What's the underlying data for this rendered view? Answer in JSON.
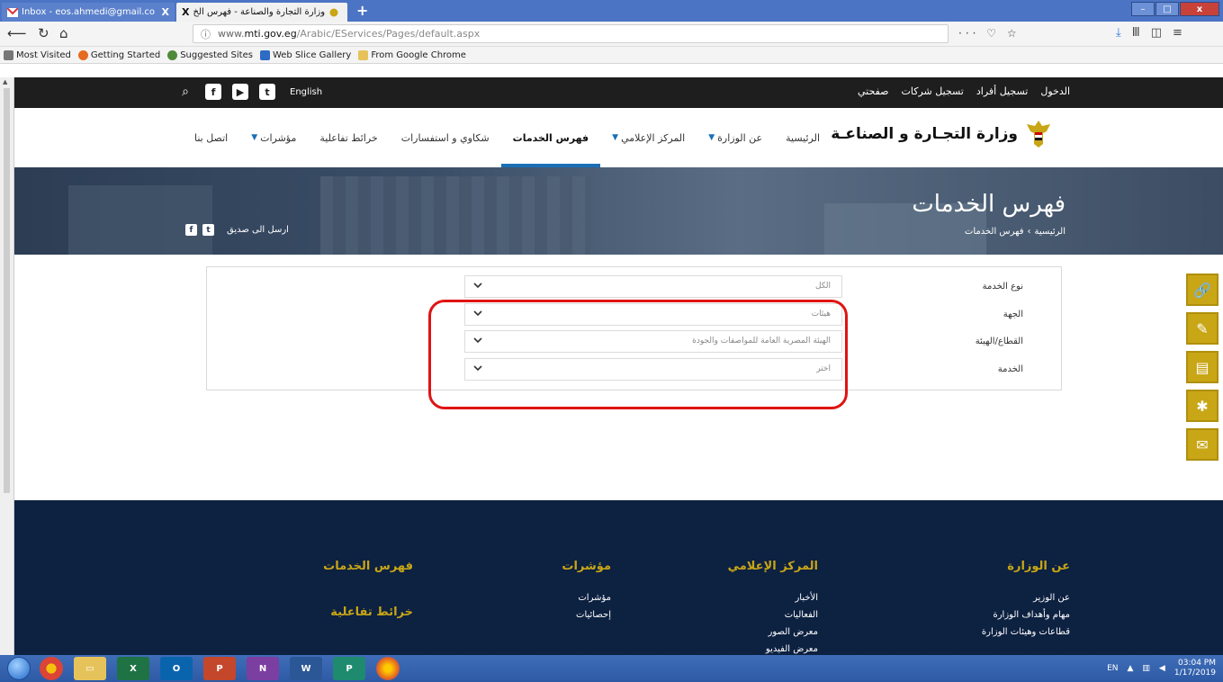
{
  "browser": {
    "tabs": [
      {
        "label": "Inbox - eos.ahmedi@gmail.co",
        "close": "X"
      },
      {
        "label": "وزارة التجارة والصناعة - فهرس الخ",
        "close": "X"
      }
    ],
    "new_tab": "+",
    "url_prefix": "www.",
    "url_host": "mti.gov.eg",
    "url_path": "/Arabic/EServices/Pages/default.aspx",
    "url_actions": "··· ♡ ☆",
    "bookmarks": [
      "Most Visited",
      "Getting Started",
      "Suggested Sites",
      "Web Slice Gallery",
      "From Google Chrome"
    ]
  },
  "site": {
    "topstrip": {
      "english_link": "English",
      "right_links": [
        "الدخول",
        "تسجيل أفراد",
        "تسجيل شركات",
        "صفحتي"
      ]
    },
    "logo_text": "وزارة التجـارة و الصناعـة",
    "nav": [
      {
        "label": "الرئيسية",
        "active": false,
        "caret": false
      },
      {
        "label": "عن الوزارة",
        "active": false,
        "caret": true
      },
      {
        "label": "المركز الإعلامي",
        "active": false,
        "caret": true
      },
      {
        "label": "فهرس الخدمات",
        "active": true,
        "caret": false
      },
      {
        "label": "شكاوي و استفسارات",
        "active": false,
        "caret": false
      },
      {
        "label": "خرائط تفاعلية",
        "active": false,
        "caret": false
      },
      {
        "label": "مؤشرات",
        "active": false,
        "caret": true
      },
      {
        "label": "اتصل بنا",
        "active": false,
        "caret": false
      }
    ],
    "hero": {
      "title": "فهرس الخدمات",
      "breadcrumb_home": "الرئيسية",
      "breadcrumb_sep": "›",
      "breadcrumb_current": "فهرس الخدمات",
      "share_label": "ارسل الى صديق"
    },
    "form": {
      "rows": [
        {
          "label": "نوع الخدمة",
          "value": "الكل"
        },
        {
          "label": "الجهة",
          "value": "هيئات"
        },
        {
          "label": "القطاع/الهيئة",
          "value": "الهيئة المصرية العامة للمواصفات والجودة"
        },
        {
          "label": "الخدمة",
          "value": "اختر"
        }
      ]
    },
    "float_icons": [
      "link-icon",
      "certificate-icon",
      "clipboard-icon",
      "feedback-icon",
      "mail-icon"
    ],
    "footer": {
      "col1": {
        "title": "عن الوزارة",
        "links": [
          "عن الوزير",
          "مهام وأهداف الوزارة",
          "قطاعات وهيئات الوزارة"
        ]
      },
      "col2": {
        "title": "المركز الإعلامي",
        "links": [
          "الأخبار",
          "الفعاليات",
          "معرض الصور",
          "معرض الفيديو"
        ]
      },
      "col3": {
        "title": "مؤشرات",
        "links": [
          "مؤشرات",
          "إحصائيات"
        ]
      },
      "col4": {
        "title": "فهرس الخدمات",
        "sub": "خرائط تفاعلية"
      }
    }
  },
  "taskbar": {
    "lang": "EN",
    "time": "03:04 PM",
    "date": "1/17/2019"
  },
  "colors": {
    "accent_blue": "#1a6fb5",
    "gold": "#c8a616",
    "footer_navy": "#0d2141",
    "highlight_red": "#e01313"
  }
}
